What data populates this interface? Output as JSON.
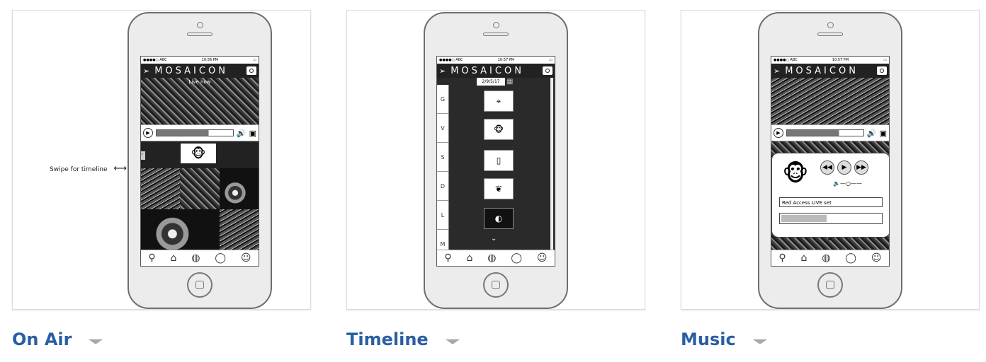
{
  "cards": [
    {
      "caption": "On Air",
      "screen": {
        "status_left": "●●●●○ ABC",
        "status_time": "10:56 PM",
        "logo": "MOSAICON",
        "live_label": "Live now",
        "annotation": "Swipe for timeline"
      }
    },
    {
      "caption": "Timeline",
      "screen": {
        "status_left": "●●●●○ ABC",
        "status_time": "10:57 PM",
        "logo": "MOSAICON",
        "date": "2/9/5/17",
        "letters": [
          "G",
          "V",
          "S",
          "D",
          "L",
          "M"
        ]
      }
    },
    {
      "caption": "Music",
      "screen": {
        "status_left": "●●●●○ ABC",
        "status_time": "10:57 PM",
        "logo": "MOSAICON",
        "track_title": "Red Access LIVE set"
      }
    }
  ],
  "tab_icons": [
    "search-icon",
    "home-icon",
    "globe-icon",
    "refresh-icon",
    "user-icon"
  ],
  "colors": {
    "caption": "#2a5ea3",
    "caret": "#a8a8a8"
  }
}
